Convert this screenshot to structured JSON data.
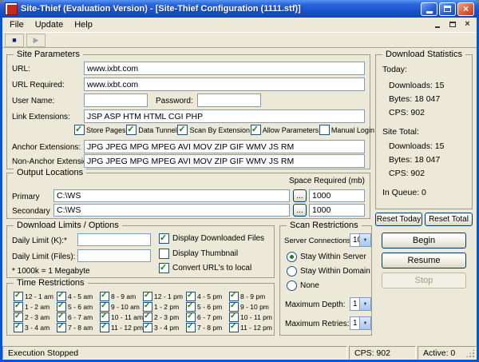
{
  "titlebar": {
    "title": "Site-Thief (Evaluation Version) - [Site-Thief Configuration (1111.stf)]",
    "close_glyph": "×"
  },
  "menubar": {
    "items": [
      {
        "label": "File"
      },
      {
        "label": "Update"
      },
      {
        "label": "Help"
      }
    ],
    "mdi_close_glyph": "×"
  },
  "toolbar": {
    "stop_glyph": "■",
    "play_glyph": "▶"
  },
  "site_parameters": {
    "legend": "Site Parameters",
    "url_label": "URL:",
    "url_value": "www.ixbt.com",
    "url_required_label": "URL Required:",
    "url_required_value": "www.ixbt.com",
    "user_name_label": "User Name:",
    "user_name_value": "",
    "password_label": "Password:",
    "password_value": "",
    "link_extensions_label": "Link Extensions:",
    "link_extensions_value": "JSP ASP HTM HTML CGI PHP",
    "checkboxes": [
      {
        "label": "Store Pages",
        "checked": true
      },
      {
        "label": "Data Tunnel",
        "checked": true
      },
      {
        "label": "Scan By Extension",
        "checked": true
      },
      {
        "label": "Allow Parameters",
        "checked": true
      },
      {
        "label": "Manual Login",
        "checked": false
      }
    ],
    "anchor_extensions_label": "Anchor Extensions:",
    "anchor_extensions_value": "JPG JPEG MPG MPEG AVI MOV ZIP GIF WMV JS RM",
    "non_anchor_extensions_label": "Non-Anchor Extensions:",
    "non_anchor_extensions_value": "JPG JPEG MPG MPEG AVI MOV ZIP GIF WMV JS RM"
  },
  "output_locations": {
    "legend": "Output Locations",
    "space_required_label": "Space Required (mb)",
    "browse_label": "...",
    "primary_label": "Primary",
    "primary_path": "C:\\WS",
    "primary_space": "1000",
    "secondary_label": "Secondary",
    "secondary_path": "C:\\WS",
    "secondary_space": "1000"
  },
  "download_limits": {
    "legend": "Download Limits / Options",
    "daily_limit_k_label": "Daily Limit (K):*",
    "daily_limit_k_value": "",
    "daily_limit_files_label": "Daily Limit (Files):",
    "daily_limit_files_value": "",
    "note": "* 1000k = 1 Megabyte",
    "options": [
      {
        "label": "Display Downloaded Files",
        "checked": true
      },
      {
        "label": "Display Thumbnail",
        "checked": false
      },
      {
        "label": "Convert URL's to local",
        "checked": true
      }
    ]
  },
  "time_restrictions": {
    "legend": "Time Restrictions",
    "slots": [
      {
        "label": "12 - 1 am",
        "checked": true
      },
      {
        "label": "1 - 2 am",
        "checked": true
      },
      {
        "label": "2 - 3 am",
        "checked": true
      },
      {
        "label": "3 - 4 am",
        "checked": true
      },
      {
        "label": "4 - 5 am",
        "checked": true
      },
      {
        "label": "5 - 6 am",
        "checked": true
      },
      {
        "label": "6 - 7 am",
        "checked": true
      },
      {
        "label": "7 - 8 am",
        "checked": true
      },
      {
        "label": "8 - 9 am",
        "checked": true
      },
      {
        "label": "9 - 10 am",
        "checked": true
      },
      {
        "label": "10 - 11 am",
        "checked": true
      },
      {
        "label": "11 - 12 pm",
        "checked": true
      },
      {
        "label": "12 - 1 pm",
        "checked": true
      },
      {
        "label": "1 - 2 pm",
        "checked": true
      },
      {
        "label": "2 - 3 pm",
        "checked": true
      },
      {
        "label": "3 - 4 pm",
        "checked": true
      },
      {
        "label": "4 - 5 pm",
        "checked": true
      },
      {
        "label": "5 - 6 pm",
        "checked": true
      },
      {
        "label": "6 - 7 pm",
        "checked": true
      },
      {
        "label": "7 - 8 pm",
        "checked": true
      },
      {
        "label": "8 - 9 pm",
        "checked": true
      },
      {
        "label": "9 - 10 pm",
        "checked": true
      },
      {
        "label": "10 - 11 pm",
        "checked": true
      },
      {
        "label": "11 - 12 pm",
        "checked": true
      }
    ]
  },
  "scan_restrictions": {
    "legend": "Scan Restrictions",
    "server_connections_label": "Server Connections:",
    "server_connections_value": "10",
    "radios": [
      {
        "label": "Stay Within Server",
        "checked": true
      },
      {
        "label": "Stay Within Domain",
        "checked": false
      },
      {
        "label": "None",
        "checked": false
      }
    ],
    "maximum_depth_label": "Maximum Depth:",
    "maximum_depth_value": "1",
    "maximum_retries_label": "Maximum Retries:",
    "maximum_retries_value": "1"
  },
  "download_statistics": {
    "legend": "Download Statistics",
    "today_label": "Today:",
    "today_downloads": "Downloads: 15",
    "today_bytes": "Bytes: 18 047",
    "today_cps": "CPS: 902",
    "site_total_label": "Site Total:",
    "total_downloads": "Downloads: 15",
    "total_bytes": "Bytes: 18 047",
    "total_cps": "CPS: 902",
    "in_queue": "In Queue: 0"
  },
  "action_buttons": {
    "reset_today": "Reset Today",
    "reset_total": "Reset Total",
    "begin": "Begin",
    "resume": "Resume",
    "stop": "Stop"
  },
  "status_bar": {
    "execution": "Execution Stopped",
    "cps": "CPS: 902",
    "active": "Active: 0"
  },
  "colors": {
    "titlebar_blue": "#1C53CC",
    "window_frame": "#0855DD",
    "client_bg": "#ECE9D8",
    "field_border": "#7F9DB9",
    "check_green": "#1E7B1E",
    "close_red": "#C23A1B"
  }
}
